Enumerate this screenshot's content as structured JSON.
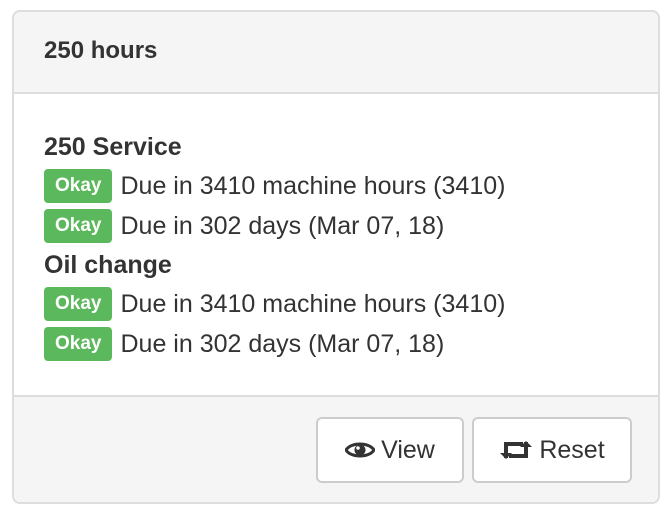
{
  "panel": {
    "title": "250 hours"
  },
  "services": [
    {
      "name": "250 Service",
      "items": [
        {
          "badge": "Okay",
          "text": "Due in 3410 machine hours (3410)"
        },
        {
          "badge": "Okay",
          "text": "Due in 302 days (Mar 07, 18)"
        }
      ]
    },
    {
      "name": "Oil change",
      "items": [
        {
          "badge": "Okay",
          "text": "Due in 3410 machine hours (3410)"
        },
        {
          "badge": "Okay",
          "text": "Due in 302 days (Mar 07, 18)"
        }
      ]
    }
  ],
  "footer": {
    "view_label": "View",
    "reset_label": "Reset"
  },
  "colors": {
    "badge_success": "#5cb85c",
    "panel_bg": "#f5f5f5",
    "border": "#dddddd"
  },
  "icons": {
    "view": "eye-icon",
    "reset": "retweet-icon"
  }
}
